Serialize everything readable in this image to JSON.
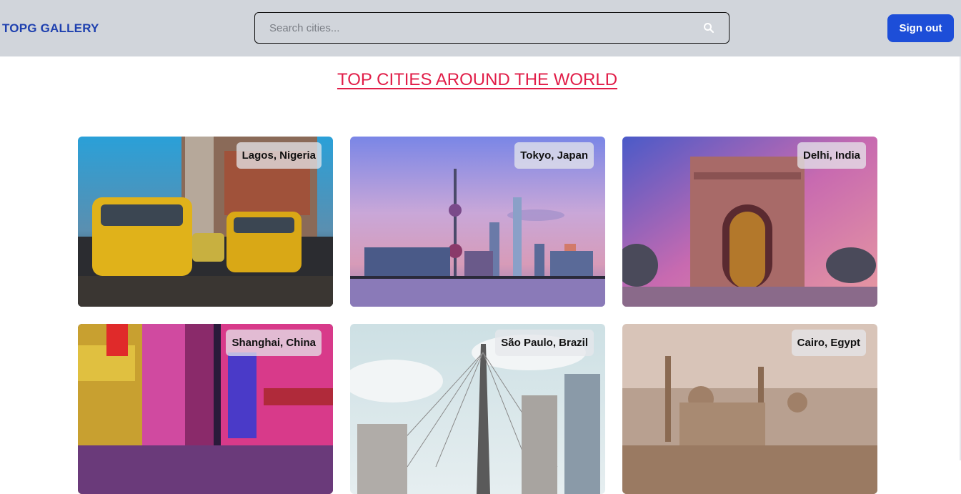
{
  "header": {
    "brand": "TOPG GALLERY",
    "search_placeholder": "Search cities...",
    "signout_label": "Sign out"
  },
  "page": {
    "title": "TOP CITIES AROUND THE WORLD"
  },
  "cities": [
    {
      "label": "Lagos, Nigeria"
    },
    {
      "label": "Tokyo, Japan"
    },
    {
      "label": "Delhi, India"
    },
    {
      "label": "Shanghai, China"
    },
    {
      "label": "São Paulo, Brazil"
    },
    {
      "label": "Cairo, Egypt"
    }
  ]
}
